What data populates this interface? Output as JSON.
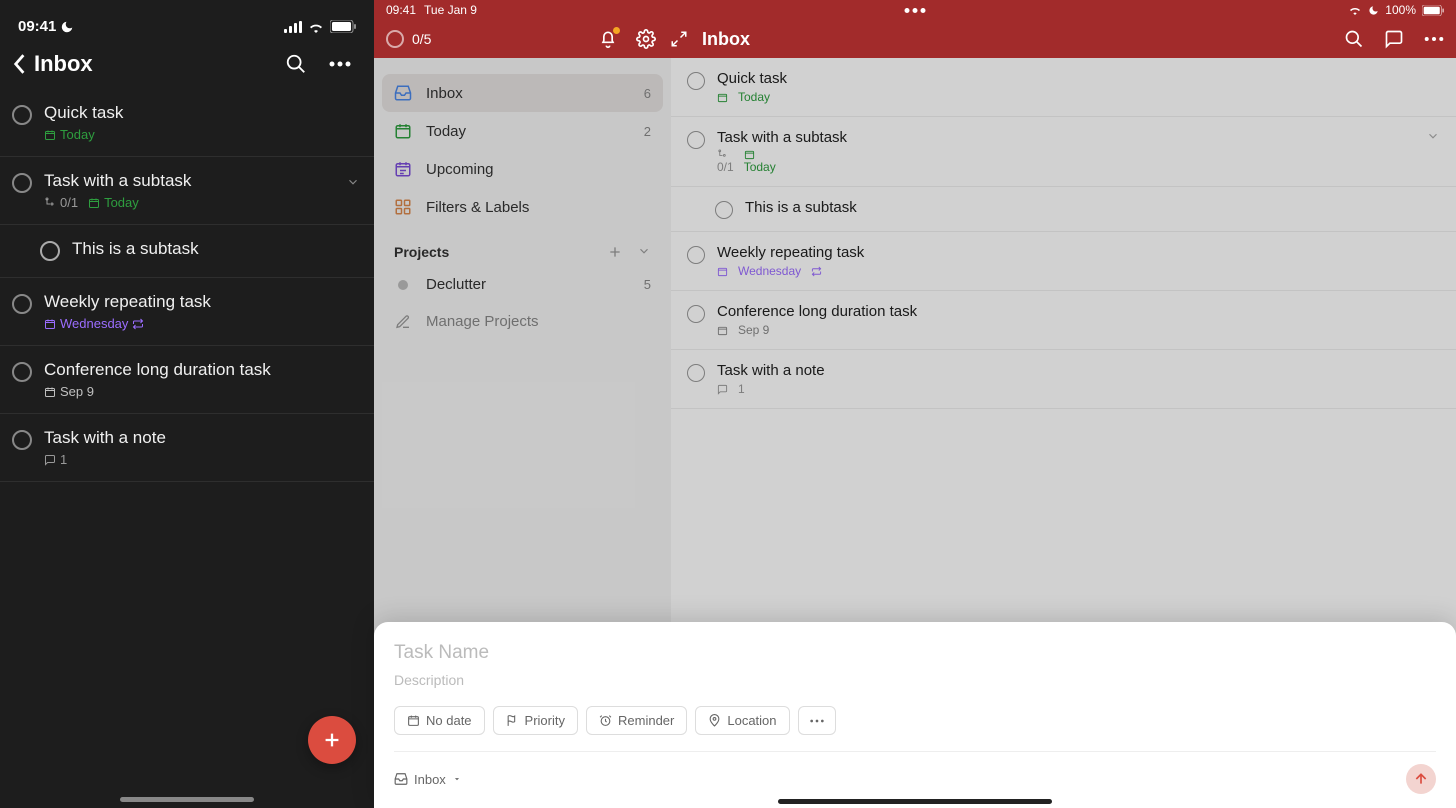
{
  "phone": {
    "status_time": "09:41",
    "title": "Inbox",
    "tasks": [
      {
        "title": "Quick task",
        "date": "Today",
        "date_class": "today-c"
      },
      {
        "title": "Task with a subtask",
        "subcount": "0/1",
        "date": "Today",
        "date_class": "today-c",
        "expandable": true
      },
      {
        "title": "This is a subtask",
        "is_sub": true
      },
      {
        "title": "Weekly repeating task",
        "date": "Wednesday",
        "date_class": "wed-c",
        "repeat": true
      },
      {
        "title": "Conference long duration task",
        "date": "Sep 9",
        "date_class": "sep-c"
      },
      {
        "title": "Task with a note",
        "comment_count": "1"
      }
    ]
  },
  "tablet": {
    "status": {
      "time": "09:41",
      "date": "Tue Jan 9",
      "battery": "100%"
    },
    "progress": "0/5",
    "title": "Inbox",
    "sidebar": {
      "items": [
        {
          "label": "Inbox",
          "count": "6",
          "active": true,
          "icon": "inbox"
        },
        {
          "label": "Today",
          "count": "2",
          "icon": "today"
        },
        {
          "label": "Upcoming",
          "icon": "upcoming"
        },
        {
          "label": "Filters & Labels",
          "icon": "filters"
        }
      ],
      "section": "Projects",
      "projects": [
        {
          "label": "Declutter",
          "count": "5"
        }
      ],
      "manage": "Manage Projects"
    },
    "tasks": [
      {
        "title": "Quick task",
        "date": "Today",
        "date_class": "mtoday"
      },
      {
        "title": "Task with a subtask",
        "subcount": "0/1",
        "date": "Today",
        "date_class": "mtoday",
        "expandable": true
      },
      {
        "title": "This is a subtask",
        "is_sub": true
      },
      {
        "title": "Weekly repeating task",
        "date": "Wednesday",
        "date_class": "mwed",
        "repeat": true
      },
      {
        "title": "Conference long duration task",
        "date": "Sep 9",
        "date_class": "msep"
      },
      {
        "title": "Task with a note",
        "comment_count": "1"
      }
    ],
    "sheet": {
      "name_placeholder": "Task Name",
      "desc_placeholder": "Description",
      "chips": {
        "date": "No date",
        "priority": "Priority",
        "reminder": "Reminder",
        "location": "Location"
      },
      "project": "Inbox"
    }
  }
}
